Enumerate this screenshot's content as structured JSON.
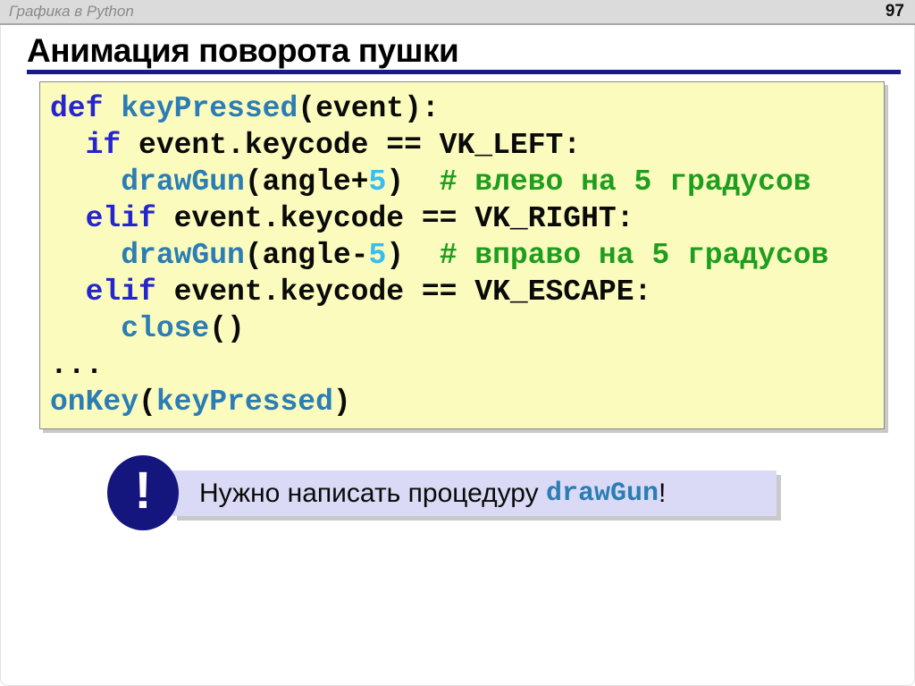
{
  "header": {
    "breadcrumb": "Графика в Python",
    "page_number": "97"
  },
  "title": "Анимация поворота пушки",
  "colors": {
    "underline": "#1a1a8c",
    "code_bg": "#fbfbbe",
    "keyword": "#2525ce",
    "function": "#2b7db4",
    "number": "#38bdf0",
    "comment": "#1e9e1e",
    "callout_bg": "#dadaf6",
    "icon_bg": "#15157e"
  },
  "code": {
    "lines": [
      [
        {
          "c": "kw",
          "t": "def"
        },
        {
          "c": "pl",
          "t": " "
        },
        {
          "c": "fn",
          "t": "keyPressed"
        },
        {
          "c": "pl",
          "t": "(event):"
        }
      ],
      [
        {
          "c": "pl",
          "t": "  "
        },
        {
          "c": "kw",
          "t": "if"
        },
        {
          "c": "pl",
          "t": " event.keycode == VK_LEFT:"
        }
      ],
      [
        {
          "c": "pl",
          "t": "    "
        },
        {
          "c": "fn",
          "t": "drawGun"
        },
        {
          "c": "pl",
          "t": "(angle+"
        },
        {
          "c": "num",
          "t": "5"
        },
        {
          "c": "pl",
          "t": ")  "
        },
        {
          "c": "cm",
          "t": "# влево на 5 градусов"
        }
      ],
      [
        {
          "c": "pl",
          "t": "  "
        },
        {
          "c": "kw",
          "t": "elif"
        },
        {
          "c": "pl",
          "t": " event.keycode == VK_RIGHT:"
        }
      ],
      [
        {
          "c": "pl",
          "t": "    "
        },
        {
          "c": "fn",
          "t": "drawGun"
        },
        {
          "c": "pl",
          "t": "(angle-"
        },
        {
          "c": "num",
          "t": "5"
        },
        {
          "c": "pl",
          "t": ")  "
        },
        {
          "c": "cm",
          "t": "# вправо на 5 градусов"
        }
      ],
      [
        {
          "c": "pl",
          "t": "  "
        },
        {
          "c": "kw",
          "t": "elif"
        },
        {
          "c": "pl",
          "t": " event.keycode == VK_ESCAPE:"
        }
      ],
      [
        {
          "c": "pl",
          "t": "    "
        },
        {
          "c": "fn",
          "t": "close"
        },
        {
          "c": "pl",
          "t": "()"
        }
      ],
      [
        {
          "c": "pl",
          "t": "..."
        }
      ],
      [
        {
          "c": "fn",
          "t": "onKey"
        },
        {
          "c": "pl",
          "t": "("
        },
        {
          "c": "fn",
          "t": "keyPressed"
        },
        {
          "c": "pl",
          "t": ")"
        }
      ]
    ]
  },
  "callout": {
    "icon_glyph": "!",
    "text_before": "Нужно написать процедуру ",
    "code_word": "drawGun",
    "text_after": "!"
  }
}
